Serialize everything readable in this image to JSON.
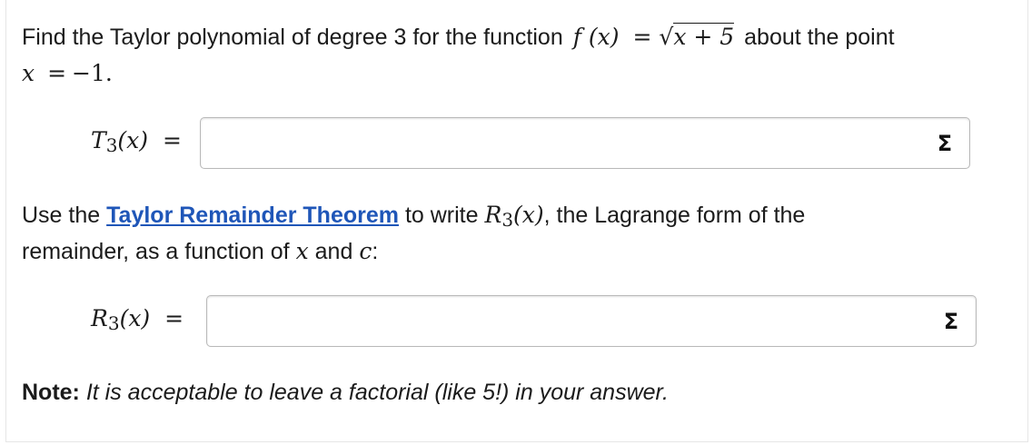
{
  "question": {
    "intro": "Find the Taylor polynomial of degree 3 for the function",
    "function_lhs": "f (x)",
    "equals": "=",
    "sqrt_symbol": "√",
    "radicand": "x + 5",
    "about_the_point": "about the point",
    "point_lhs": "x",
    "point_value": "−1",
    "period": "."
  },
  "t3": {
    "label_letter": "T",
    "label_sub": "3",
    "label_arg": "(x)",
    "equals": "=",
    "value": "",
    "sigma_icon": "Σ"
  },
  "remainder_prompt": {
    "use_the": "Use the",
    "link_text": "Taylor Remainder Theorem",
    "to_write": "to write",
    "r_letter": "R",
    "r_sub": "3",
    "r_arg": "(x)",
    "rest": ", the Lagrange form of the",
    "line2": "remainder, as a function of",
    "var_x": "x",
    "and": "and",
    "var_c": "c",
    "colon": ":"
  },
  "r3": {
    "label_letter": "R",
    "label_sub": "3",
    "label_arg": "(x)",
    "equals": "=",
    "value": "",
    "sigma_icon": "Σ"
  },
  "note": {
    "label": "Note:",
    "text": "It is acceptable to leave a factorial (like 5!) in your answer."
  }
}
